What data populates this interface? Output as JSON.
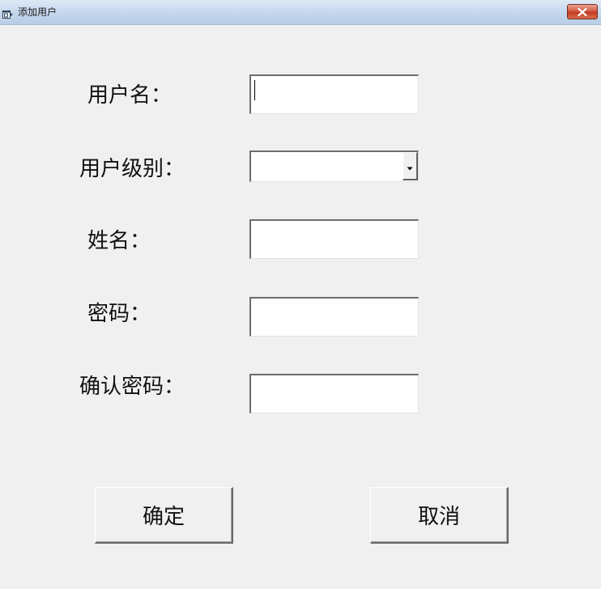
{
  "window": {
    "title": "添加用户",
    "close_icon": "close-icon",
    "app_icon": "app-window-icon"
  },
  "form": {
    "username": {
      "label": "用户名：",
      "value": ""
    },
    "user_level": {
      "label": "用户级别：",
      "value": ""
    },
    "name": {
      "label": "姓名：",
      "value": ""
    },
    "password": {
      "label": "密码：",
      "value": ""
    },
    "confirm_password": {
      "label": "确认密码：",
      "value": ""
    }
  },
  "buttons": {
    "ok_label": "确定",
    "cancel_label": "取消"
  },
  "colors": {
    "background": "#f0f0f0",
    "close_button": "#c33a20"
  }
}
